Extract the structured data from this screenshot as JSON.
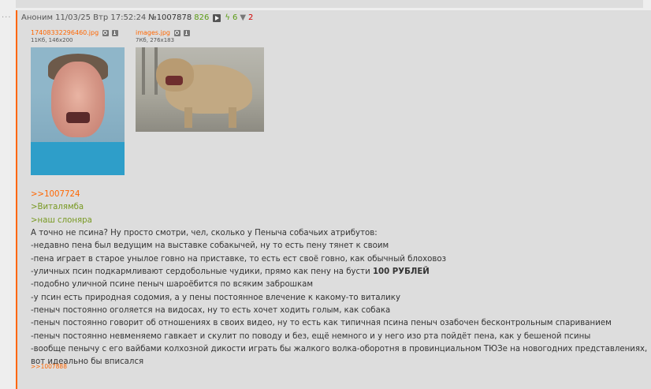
{
  "post": {
    "author": "Аноним",
    "date": "11/03/25 Втр 17:52:24",
    "number": "№1007878",
    "views": "826",
    "likes": "6",
    "dislikes": "2",
    "accent_color": "#ff6600",
    "quote_color": "#789922"
  },
  "files": [
    {
      "name": "17408332296460.jpg",
      "meta": "11Кб, 146x200"
    },
    {
      "name": "images.jpg",
      "meta": "7Кб, 276x183"
    }
  ],
  "message": {
    "reply_link": ">>1007724",
    "quote1": ">Виталямба",
    "quote2": ">наш слоняра",
    "line1": "А точно не псина? Ну просто смотри, чел, сколько у Пеныча собачьих атрибутов:",
    "line2": "-недавно пена был ведущим на выставке собакычей, ну то есть пену тянет к своим",
    "line3": "-пена играет в старое унылое говно на приставке, то есть ест своё говно, как обычный блоховоз",
    "line4_a": "-уличных псин подкармливают сердобольные чудики, прямо как пену на бусти ",
    "line4_b": "100 РУБЛЕЙ",
    "line5": "-подобно уличной псине пеныч шароёбится по всяким заброшкам",
    "line6": "-у псин есть природная содомия, а у пены постоянное влечение к какому-то виталику",
    "line7": "-пеныч постоянно оголяется на видосах, ну то есть хочет ходить голым, как собака",
    "line8": "-пеныч постоянно говорит об отношениях в своих видео, ну то есть как типичная псина пеныч озабочен бесконтрольным спариванием",
    "line9": "-пеныч постоянно невменяемо гавкает и скулит по поводу и без, ещё немного и у него изо рта пойдёт пена, как у бешеной псины",
    "line10": "-вообще пенычу с его вайбами колхозной дикости играть бы жалкого волка-оборотня в провинциальном ТЮЗе на новогодних представлениях, вот идеально бы вписался"
  },
  "replies": [
    ">>1007888"
  ],
  "icons": [
    "play-icon",
    "bolt-icon",
    "thumbs-down-icon",
    "search-icon",
    "download-icon"
  ]
}
